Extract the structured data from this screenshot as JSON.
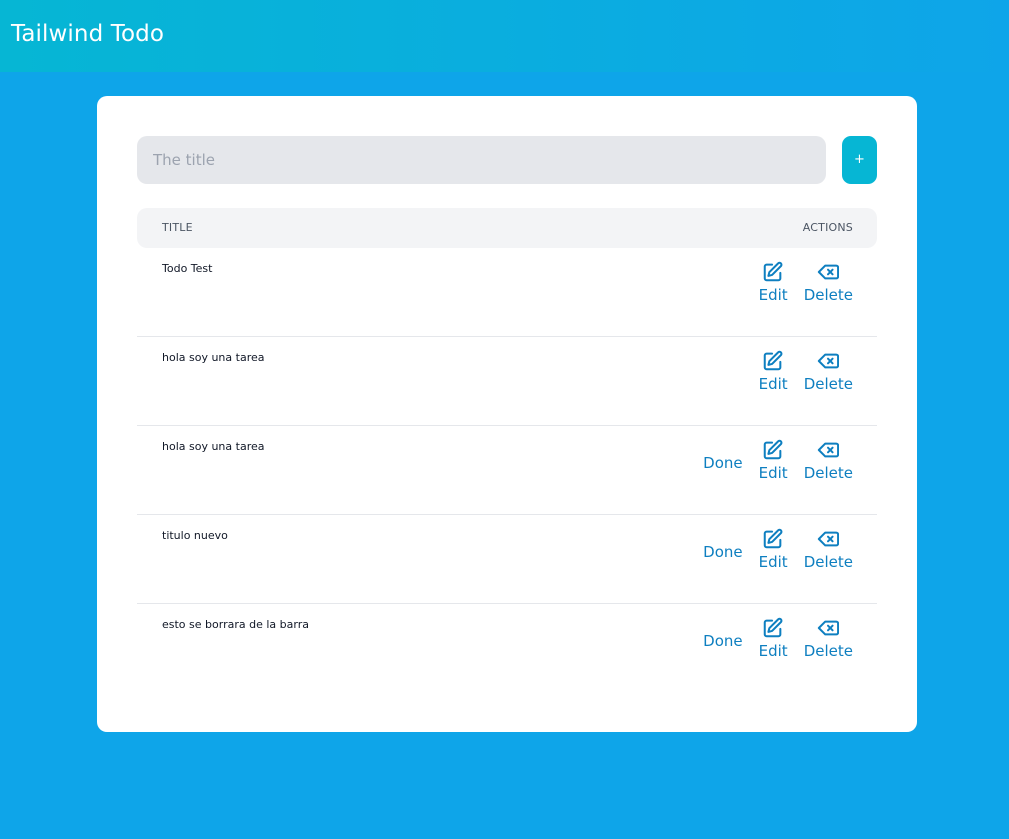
{
  "app": {
    "title": "Tailwind Todo"
  },
  "colors": {
    "background": "#0ea5e9",
    "header_gradient_start": "#06b6d4",
    "accent": "#06b6d4",
    "link": "#0e7fc0"
  },
  "form": {
    "title_placeholder": "The title",
    "title_value": "",
    "add_label": "+"
  },
  "table": {
    "headers": {
      "title": "TITLE",
      "actions": "ACTIONS"
    },
    "labels": {
      "done": "Done",
      "edit": "Edit",
      "delete": "Delete"
    },
    "icons": {
      "edit": "edit-icon",
      "delete": "backspace-delete-icon"
    },
    "rows": [
      {
        "title": "Todo Test",
        "show_done": false
      },
      {
        "title": "hola soy una tarea",
        "show_done": false
      },
      {
        "title": "hola soy una tarea",
        "show_done": true
      },
      {
        "title": "titulo nuevo",
        "show_done": true
      },
      {
        "title": "esto se borrara de la barra",
        "show_done": true
      }
    ]
  }
}
